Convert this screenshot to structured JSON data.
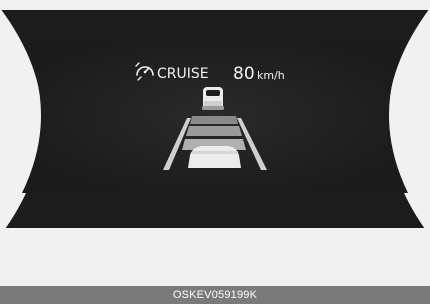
{
  "display": {
    "cruise_label": "CRUISE",
    "speed_value": "80",
    "speed_unit": "km/h",
    "cruise_icon": "cruise-control-icon",
    "lead_vehicle_icon": "lead-vehicle-icon",
    "distance_level": "4 of 4 bars"
  },
  "footer": {
    "image_code": "OSKEV059199K"
  },
  "colors": {
    "panel_dark": "#1f1f1f",
    "panel_edge": "#2a2a2a",
    "lane_bar_light": "#bdbdbd",
    "lane_bar_dark": "#7c7c7c",
    "text": "#f2f2f2",
    "footer_bg": "#7a7a7a",
    "page_bg": "#f1f1f1"
  }
}
